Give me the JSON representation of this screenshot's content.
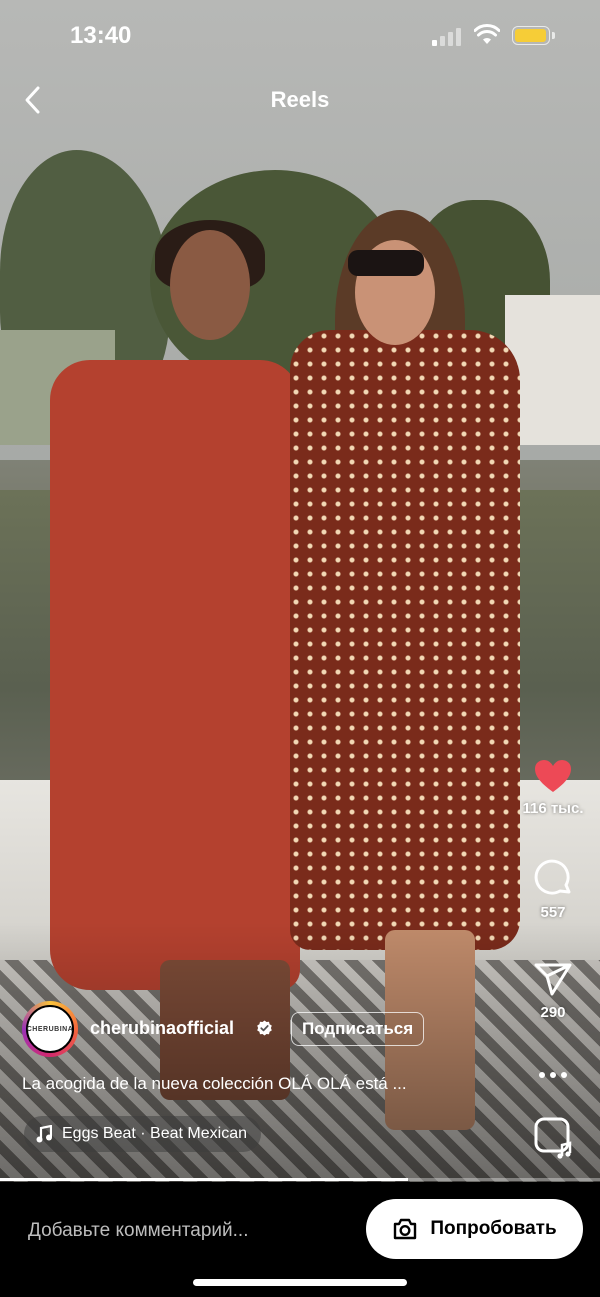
{
  "status_bar": {
    "time": "13:40",
    "battery_color": "#f6cd37"
  },
  "header": {
    "title": "Reels",
    "back_icon": "chevron-left-icon"
  },
  "rail": {
    "likes": "116 тыс.",
    "comments": "557",
    "shares": "290",
    "like_color": "#ed4956"
  },
  "post": {
    "avatar_text": "CHERUBINA",
    "username": "cherubinaofficial",
    "follow_label": "Подписаться",
    "caption": "La acogida de la nueva colección OLÁ OLÁ está ...",
    "music": "Eggs Beat · Beat Mexican",
    "progress": 0.68
  },
  "bottom": {
    "comment_placeholder": "Добавьте комментарий...",
    "try_label": "Попробовать"
  }
}
